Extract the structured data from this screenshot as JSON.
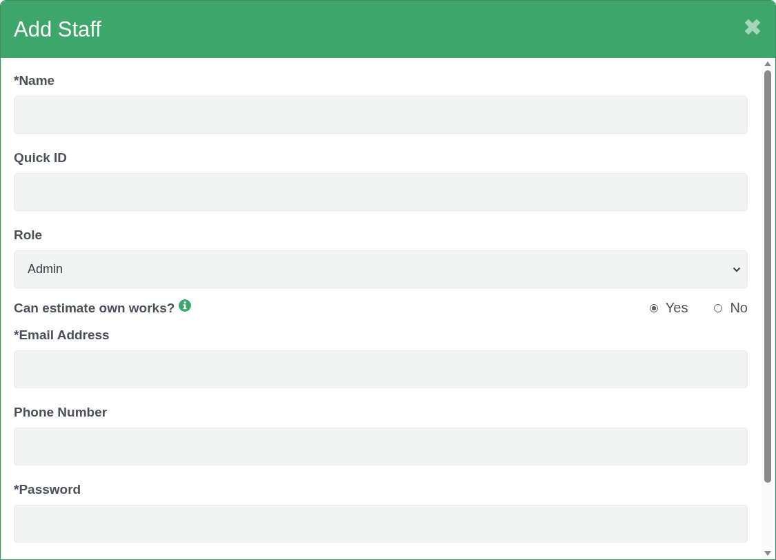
{
  "dialog": {
    "title": "Add Staff"
  },
  "fields": [
    {
      "kind": "text",
      "label": "*Name"
    },
    {
      "kind": "text",
      "label": "Quick ID"
    },
    {
      "kind": "select",
      "label": "Role",
      "value": "Admin"
    },
    {
      "kind": "radio",
      "label": "Can estimate own works?",
      "info": true,
      "options": [
        {
          "label": "Yes",
          "selected": true
        },
        {
          "label": "No",
          "selected": false
        }
      ]
    },
    {
      "kind": "text",
      "label": "*Email Address"
    },
    {
      "kind": "text",
      "label": "Phone Number"
    },
    {
      "kind": "text",
      "label": "*Password"
    }
  ]
}
